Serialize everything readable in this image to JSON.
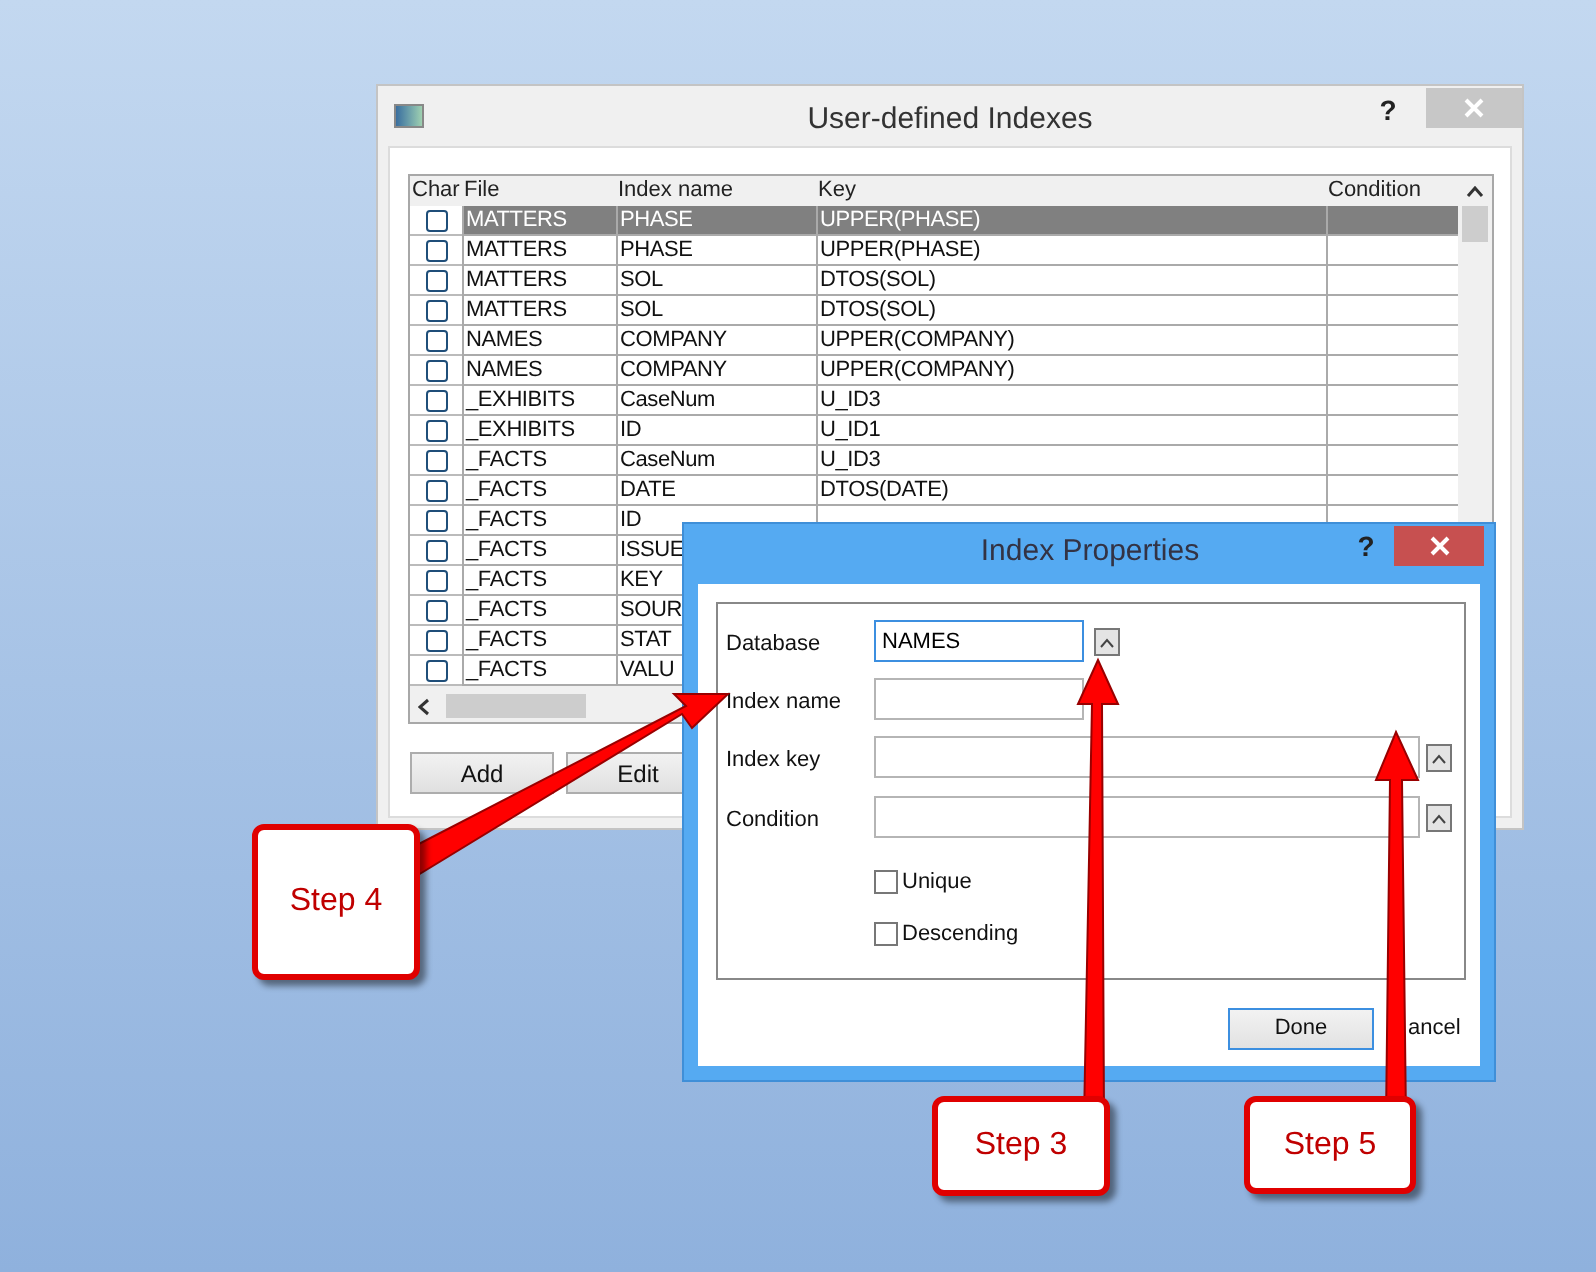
{
  "main_window": {
    "title": "User-defined Indexes",
    "help_label": "?",
    "table": {
      "columns": [
        "Char",
        "File",
        "Index name",
        "Key",
        "Condition"
      ],
      "rows": [
        {
          "checked": false,
          "selected": true,
          "file": "MATTERS",
          "index_name": "PHASE",
          "key": "UPPER(PHASE)"
        },
        {
          "checked": false,
          "selected": false,
          "file": "MATTERS",
          "index_name": "PHASE",
          "key": "UPPER(PHASE)"
        },
        {
          "checked": false,
          "selected": false,
          "file": "MATTERS",
          "index_name": "SOL",
          "key": "DTOS(SOL)"
        },
        {
          "checked": false,
          "selected": false,
          "file": "MATTERS",
          "index_name": "SOL",
          "key": "DTOS(SOL)"
        },
        {
          "checked": false,
          "selected": false,
          "file": "NAMES",
          "index_name": "COMPANY",
          "key": "UPPER(COMPANY)"
        },
        {
          "checked": false,
          "selected": false,
          "file": "NAMES",
          "index_name": "COMPANY",
          "key": "UPPER(COMPANY)"
        },
        {
          "checked": false,
          "selected": false,
          "file": "_EXHIBITS",
          "index_name": "CaseNum",
          "key": "U_ID3"
        },
        {
          "checked": false,
          "selected": false,
          "file": "_EXHIBITS",
          "index_name": "ID",
          "key": "U_ID1"
        },
        {
          "checked": false,
          "selected": false,
          "file": "_FACTS",
          "index_name": "CaseNum",
          "key": "U_ID3"
        },
        {
          "checked": false,
          "selected": false,
          "file": "_FACTS",
          "index_name": "DATE",
          "key": "DTOS(DATE)"
        },
        {
          "checked": false,
          "selected": false,
          "file": "_FACTS",
          "index_name": "ID"
        },
        {
          "checked": false,
          "selected": false,
          "file": "_FACTS",
          "index_name": "ISSUE"
        },
        {
          "checked": false,
          "selected": false,
          "file": "_FACTS",
          "index_name": "KEY"
        },
        {
          "checked": false,
          "selected": false,
          "file": "_FACTS",
          "index_name": "SOUR"
        },
        {
          "checked": false,
          "selected": false,
          "file": "_FACTS",
          "index_name": "STAT"
        },
        {
          "checked": false,
          "selected": false,
          "file": "_FACTS",
          "index_name": "VALU"
        }
      ]
    },
    "buttons": [
      "Add",
      "Edit"
    ]
  },
  "dialog": {
    "title": "Index Properties",
    "help_label": "?",
    "fields": [
      {
        "label": "Database",
        "value": "NAMES",
        "focused": true,
        "wide": false,
        "kind": "picker"
      },
      {
        "label": "Index name",
        "focused": false,
        "wide": false,
        "kind": "plain"
      },
      {
        "label": "Index key",
        "focused": false,
        "wide": true,
        "kind": "picker"
      },
      {
        "label": "Condition",
        "focused": false,
        "wide": true,
        "kind": "picker"
      }
    ],
    "options": [
      {
        "label": "Unique",
        "checked": false
      },
      {
        "label": "Descending",
        "checked": false
      }
    ],
    "buttons": [
      "Done",
      "ancel"
    ]
  },
  "callouts": [
    "Step 4",
    "Step 3",
    "Step 5"
  ]
}
